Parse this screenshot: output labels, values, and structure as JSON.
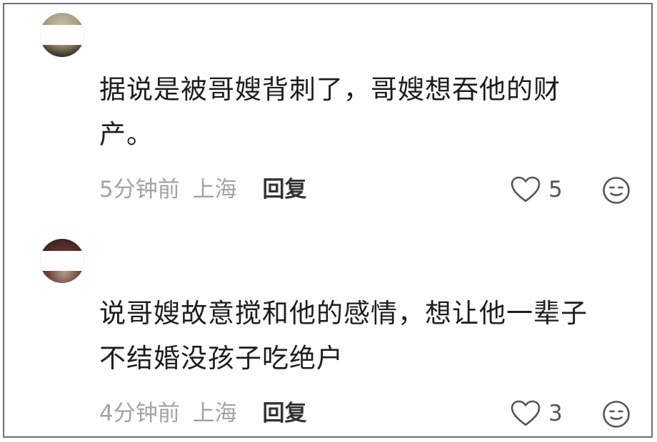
{
  "comments": [
    {
      "text_line1": "据说是被哥嫂背刺了，哥嫂想吞他的财",
      "text_line2": "产。",
      "time": "5分钟前",
      "location": "上海",
      "reply_label": "回复",
      "likes": "5",
      "avatar_icon": "user-avatar",
      "like_icon": "heart-outline-icon",
      "reaction_icon": "emoji-face-icon"
    },
    {
      "text_line1": "说哥嫂故意搅和他的感情，想让他一辈子",
      "text_line2": "不结婚没孩子吃绝户",
      "time": "4分钟前",
      "location": "上海",
      "reply_label": "回复",
      "likes": "3",
      "avatar_icon": "user-avatar",
      "like_icon": "heart-outline-icon",
      "reaction_icon": "emoji-face-icon"
    }
  ],
  "colors": {
    "text": "#1d1d1d",
    "meta": "#a3a3a3",
    "reply": "#333333",
    "icon": "#555555",
    "border": "#6f6f6f"
  }
}
